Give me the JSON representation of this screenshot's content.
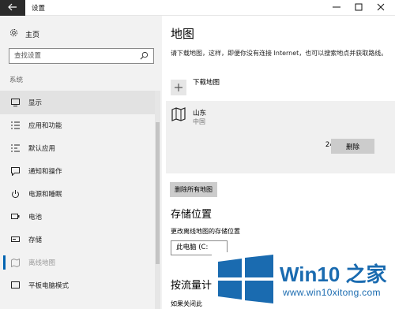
{
  "window": {
    "title": "设置",
    "back_icon": "back-arrow-icon",
    "controls": [
      "minimize-icon",
      "maximize-icon",
      "close-icon"
    ]
  },
  "sidebar": {
    "home_label": "主页",
    "search_placeholder": "查找设置",
    "section_label": "系统",
    "items": [
      {
        "label": "显示",
        "icon": "monitor-icon",
        "state": "hover"
      },
      {
        "label": "应用和功能",
        "icon": "list-icon"
      },
      {
        "label": "默认应用",
        "icon": "default-apps-icon"
      },
      {
        "label": "通知和操作",
        "icon": "notification-icon"
      },
      {
        "label": "电源和睡眠",
        "icon": "power-icon"
      },
      {
        "label": "电池",
        "icon": "battery-icon"
      },
      {
        "label": "存储",
        "icon": "storage-icon"
      },
      {
        "label": "离线地图",
        "icon": "map-icon",
        "state": "selected"
      },
      {
        "label": "平板电脑模式",
        "icon": "tablet-icon"
      }
    ]
  },
  "main": {
    "title": "地图",
    "description": "请下载地图，这样，即便你没有连接 Internet，也可以搜索地点并获取路线。",
    "download_label": "下载地图",
    "map_entry": {
      "name": "山东",
      "country": "中国",
      "size": "240 MB",
      "delete_label": "删除"
    },
    "delete_all_label": "删除所有地图",
    "storage": {
      "heading": "存储位置",
      "label": "更改离线地图的存储位置",
      "selected": "此电脑 (C:"
    },
    "metered": {
      "heading": "按流量计",
      "partial_text": "如果关闭此"
    }
  },
  "watermark": {
    "title": "Win10 之家",
    "url": "www.win10xitong.com",
    "colors": {
      "blue": "#1a6bb0"
    }
  }
}
